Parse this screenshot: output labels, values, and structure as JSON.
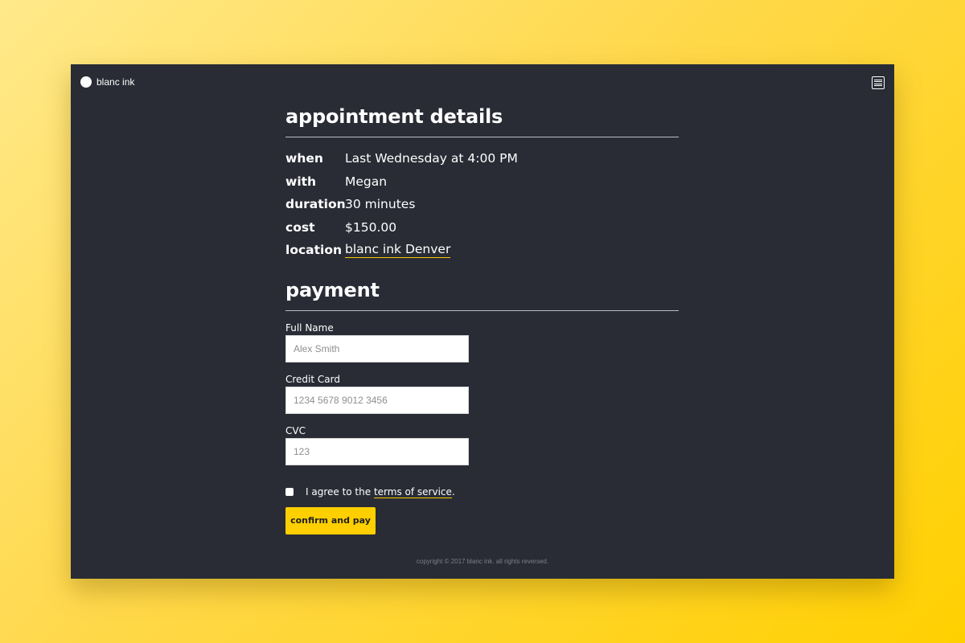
{
  "brand": {
    "name": "blanc ink",
    "icon": "circle-logo-icon"
  },
  "header": {
    "menu_icon": "menu-icon"
  },
  "appointment": {
    "title": "appointment details",
    "rows": [
      {
        "label": "when",
        "value": "Last Wednesday at 4:00 PM"
      },
      {
        "label": "with",
        "value": "Megan"
      },
      {
        "label": "duration",
        "value": "30 minutes"
      },
      {
        "label": "cost",
        "value": "$150.00"
      },
      {
        "label": "location",
        "value": "blanc ink Denver"
      }
    ]
  },
  "payment": {
    "title": "payment",
    "fields": [
      {
        "label": "Full Name",
        "placeholder": "Alex Smith",
        "value": ""
      },
      {
        "label": "Credit Card",
        "placeholder": "1234 5678 9012 3456",
        "value": ""
      },
      {
        "label": "CVC",
        "placeholder": "123",
        "value": ""
      }
    ],
    "agree_prefix": "I agree to the ",
    "agree_link": "terms of service",
    "agree_suffix": ".",
    "agree_checked": false,
    "submit_label": "confirm and pay"
  },
  "footer": {
    "text": "copyright © 2017 blanc ink. all rights reversed."
  },
  "colors": {
    "accent": "#ffcf00",
    "panel": "#292c35",
    "background_gradient_start": "#ffe98a",
    "background_gradient_end": "#ffd000"
  }
}
